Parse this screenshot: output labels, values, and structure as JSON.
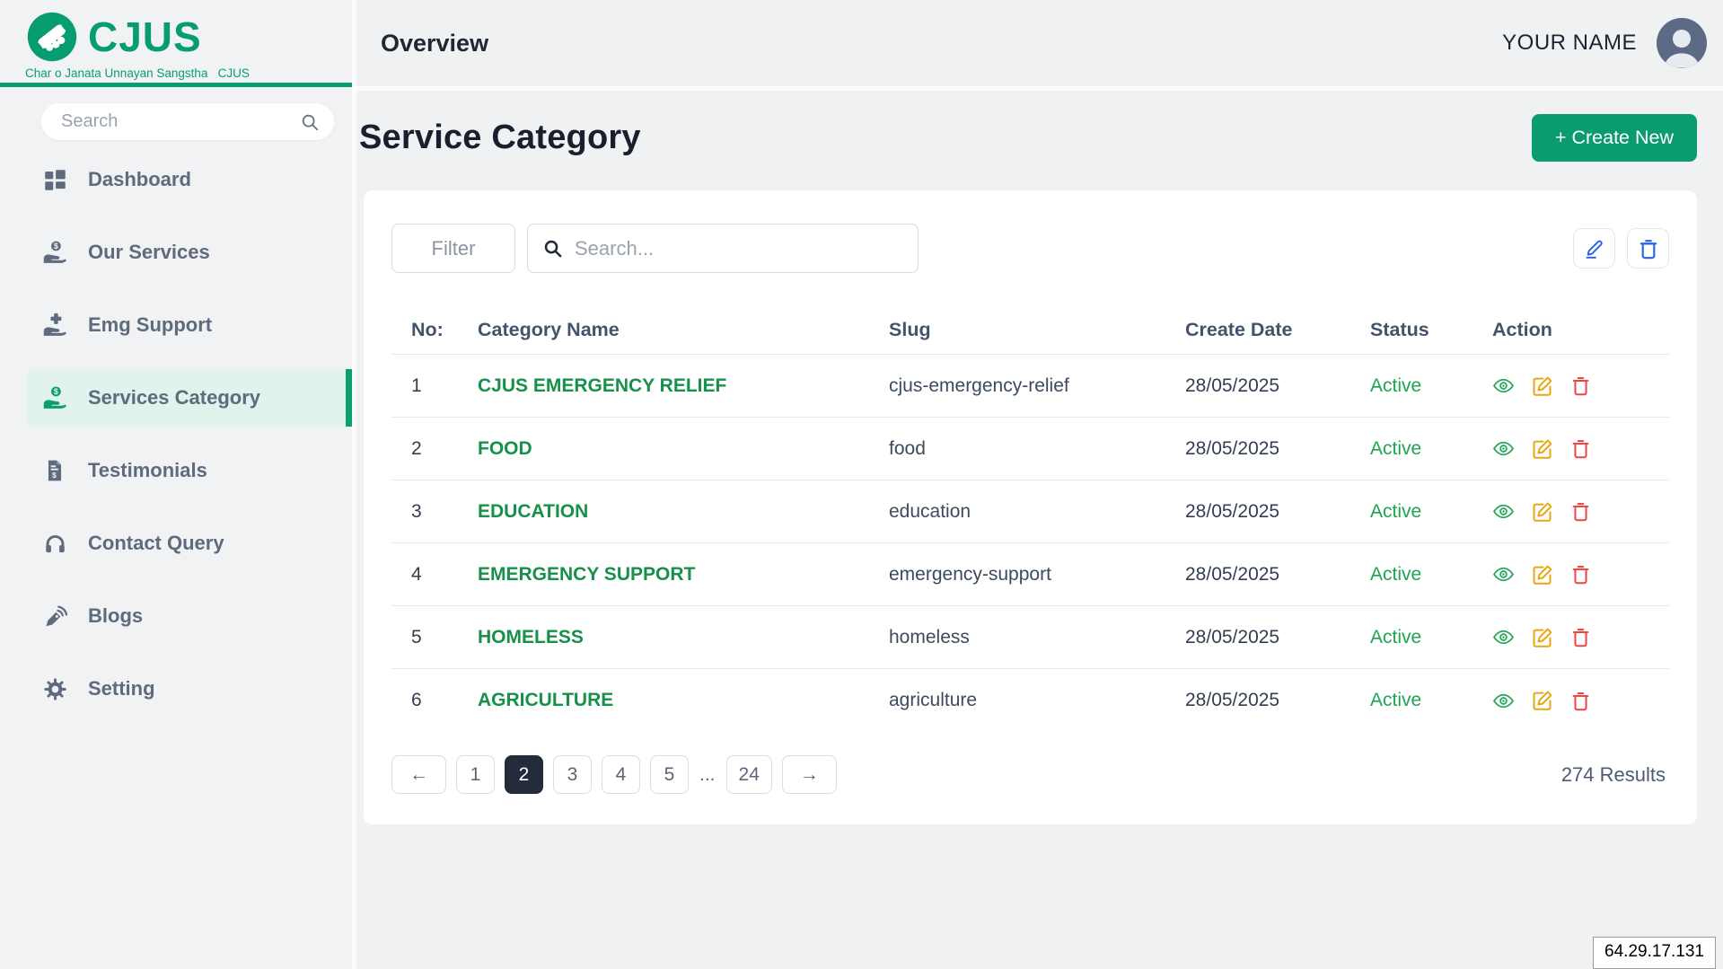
{
  "brand": {
    "name": "CJUS",
    "tagline": "Char o Janata Unnayan Sangstha   CJUS",
    "logo_icon": "handshake-icon"
  },
  "sidebar": {
    "search_placeholder": "Search",
    "items": [
      {
        "label": "Dashboard",
        "icon": "dashboard-grid-icon",
        "active": false
      },
      {
        "label": "Our Services",
        "icon": "hand-holding-dollar-icon",
        "active": false
      },
      {
        "label": "Emg Support",
        "icon": "hand-holding-plus-icon",
        "active": false
      },
      {
        "label": "Services Category",
        "icon": "hand-holding-dollar-icon",
        "active": true
      },
      {
        "label": "Testimonials",
        "icon": "invoice-dollar-icon",
        "active": false
      },
      {
        "label": "Contact Query",
        "icon": "headphones-icon",
        "active": false
      },
      {
        "label": "Blogs",
        "icon": "blog-pen-icon",
        "active": false
      },
      {
        "label": "Setting",
        "icon": "gear-icon",
        "active": false
      }
    ]
  },
  "header": {
    "title": "Overview",
    "user_name": "YOUR NAME"
  },
  "page": {
    "title": "Service Category",
    "create_button": "+ Create New"
  },
  "toolbar": {
    "filter_label": "Filter",
    "search_placeholder": "Search..."
  },
  "table": {
    "columns": [
      "No:",
      "Category Name",
      "Slug",
      "Create Date",
      "Status",
      "Action"
    ],
    "rows": [
      {
        "no": "1",
        "name": "CJUS EMERGENCY RELIEF",
        "slug": "cjus-emergency-relief",
        "date": "28/05/2025",
        "status": "Active"
      },
      {
        "no": "2",
        "name": "FOOD",
        "slug": "food",
        "date": "28/05/2025",
        "status": "Active"
      },
      {
        "no": "3",
        "name": "EDUCATION",
        "slug": "education",
        "date": "28/05/2025",
        "status": "Active"
      },
      {
        "no": "4",
        "name": "EMERGENCY SUPPORT",
        "slug": "emergency-support",
        "date": "28/05/2025",
        "status": "Active"
      },
      {
        "no": "5",
        "name": "HOMELESS",
        "slug": "homeless",
        "date": "28/05/2025",
        "status": "Active"
      },
      {
        "no": "6",
        "name": "AGRICULTURE",
        "slug": "agriculture",
        "date": "28/05/2025",
        "status": "Active"
      }
    ]
  },
  "pagination": {
    "prev": "←",
    "next": "→",
    "pages": [
      "1",
      "2",
      "3",
      "4",
      "5"
    ],
    "ellipsis": "...",
    "last": "24",
    "active_page": "2",
    "results": "274 Results"
  },
  "footer": {
    "ip": "64.29.17.131"
  },
  "colors": {
    "brand_green": "#089d70",
    "button_green": "#0a9c6f",
    "active_item_bg": "#e2f2ec",
    "active_bar_green": "#0b9e6f",
    "category_link_green": "#17904a",
    "status_green": "#1fa452",
    "view_icon_green": "#29a65a",
    "edit_icon_yellow": "#e7a712",
    "delete_icon_red": "#ef4545",
    "tool_icon_blue": "#2563eb",
    "active_page_bg": "#232c3a"
  }
}
